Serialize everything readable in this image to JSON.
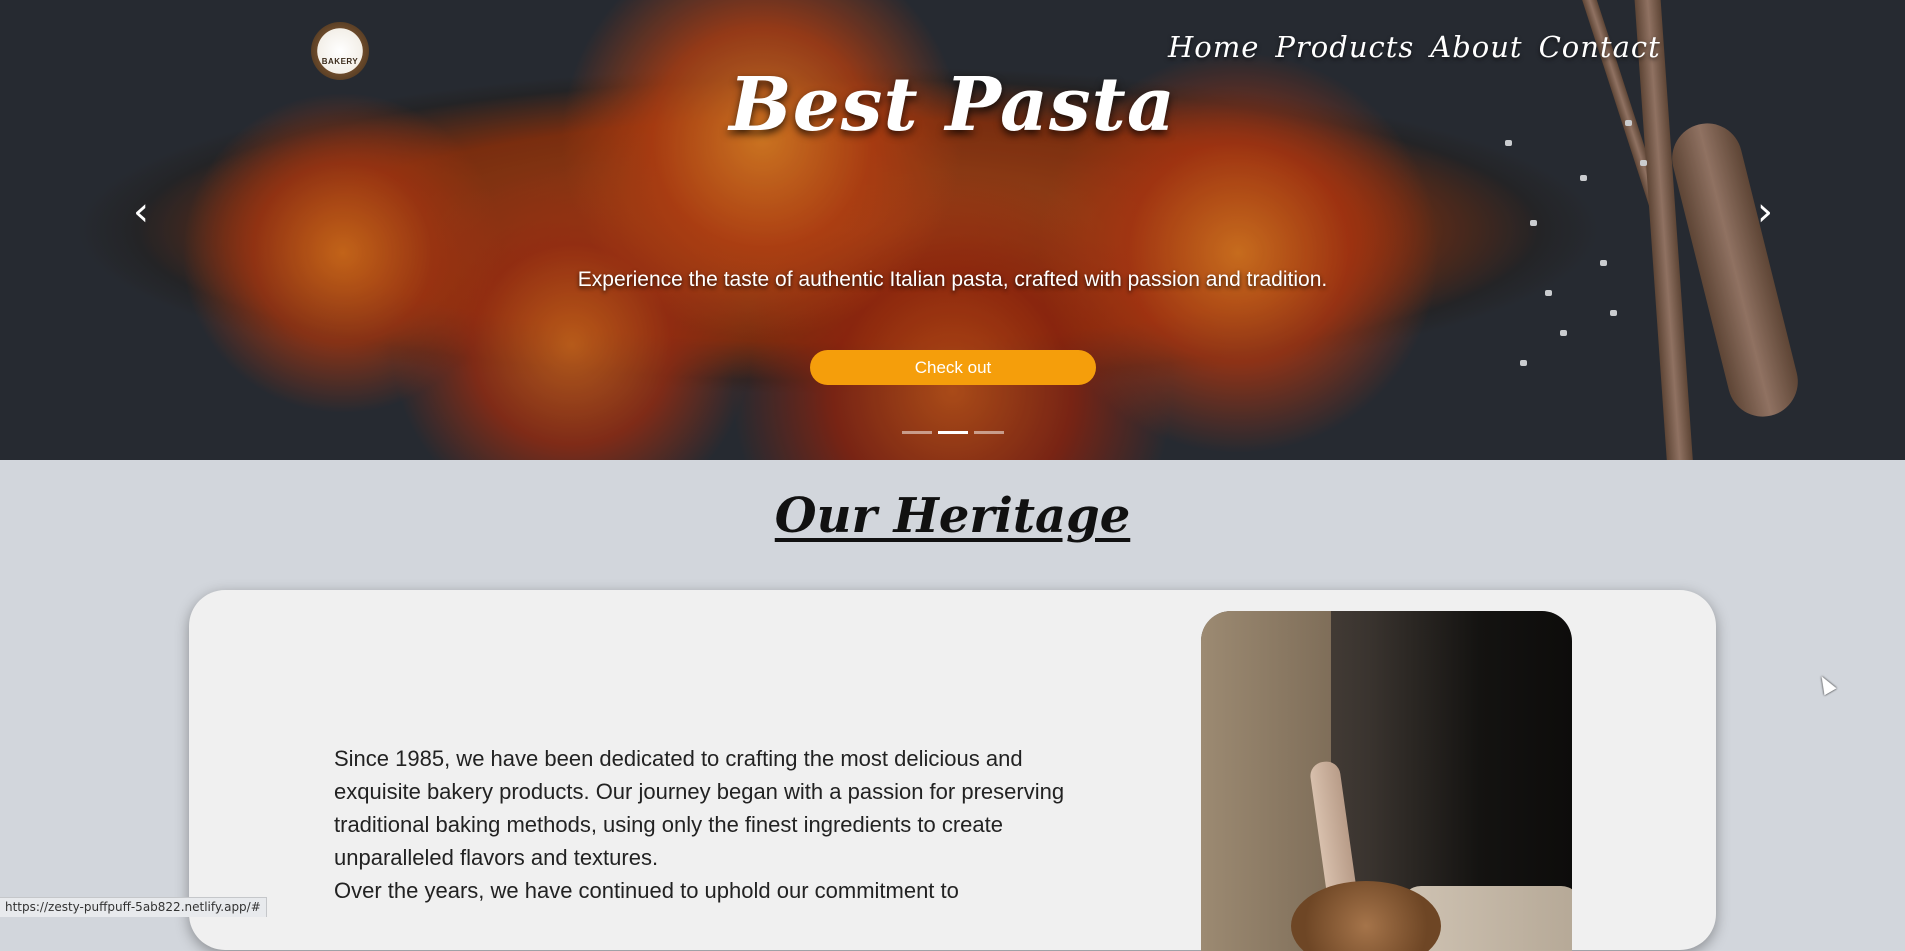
{
  "header": {
    "logo_text": "BAKERY",
    "nav": [
      {
        "label": "Home"
      },
      {
        "label": "Products"
      },
      {
        "label": "About"
      },
      {
        "label": "Contact"
      }
    ]
  },
  "hero": {
    "title": "Best Pasta",
    "subtitle": "Experience the taste of authentic Italian pasta, crafted with passion and tradition.",
    "cta_label": "Check out",
    "prev_icon": "chevron-left-icon",
    "next_icon": "chevron-right-icon",
    "slide_count": 3,
    "active_slide": 2
  },
  "heritage": {
    "title": "Our Heritage",
    "paragraph1": "Since 1985, we have been dedicated to crafting the most delicious and exquisite bakery products. Our journey began with a passion for preserving traditional baking methods, using only the finest ingredients to create unparalleled flavors and textures.",
    "paragraph2": "Over the years, we have continued to uphold our commitment to"
  },
  "status_bar": {
    "url": "https://zesty-puffpuff-5ab822.netlify.app/#"
  },
  "colors": {
    "accent": "#f59e0b",
    "background": "#d2d6dc",
    "card": "#f0f0f0"
  }
}
